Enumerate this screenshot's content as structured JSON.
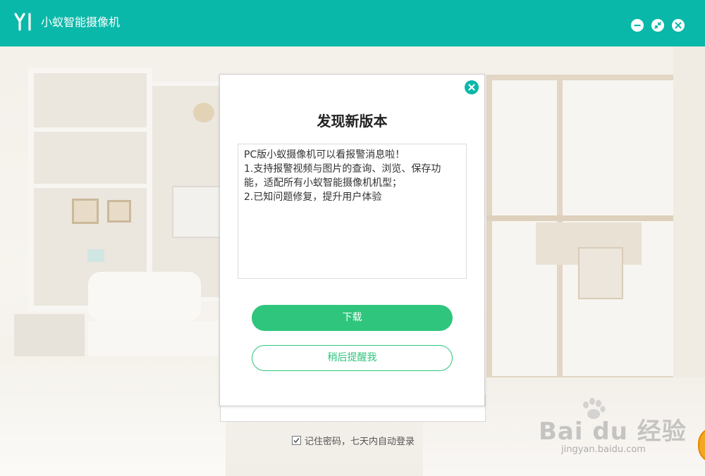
{
  "app": {
    "logo_text": "YI",
    "title": "小蚁智能摄像机"
  },
  "window_controls": {
    "minimize_icon": "minus-circle-icon",
    "restore_icon": "collapse-arrows-icon",
    "close_icon": "x-circle-icon"
  },
  "colors": {
    "brand_teal": "#0ab8a9",
    "primary_green": "#2fc57c"
  },
  "dialog": {
    "title": "发现新版本",
    "notes": [
      "PC版小蚁摄像机可以看报警消息啦！",
      "1.支持报警视频与图片的查询、浏览、保存功",
      "能，适配所有小蚁智能摄像机机型；",
      "2.已知问题修复，提升用户体验"
    ],
    "download_label": "下载",
    "later_label": "稍后提醒我",
    "close_icon": "close-circle-icon"
  },
  "login": {
    "remember_label": "记住密码，七天内自动登录",
    "remember_checked": true
  },
  "watermark": {
    "brand": "Bai du 经验",
    "url": "jingyan.baidu.com"
  }
}
